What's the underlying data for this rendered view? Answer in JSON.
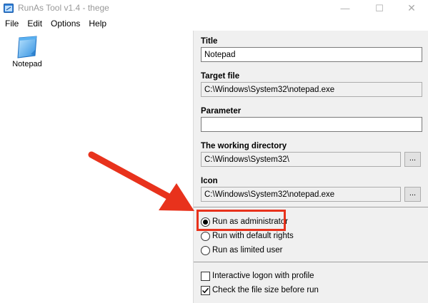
{
  "window": {
    "title": "RunAs Tool v1.4 - thege",
    "minimize_glyph": "—",
    "maximize_glyph": "☐",
    "close_glyph": "✕"
  },
  "menu": [
    "File",
    "Edit",
    "Options",
    "Help"
  ],
  "shortcuts": [
    {
      "label": "Notepad",
      "icon": "notepad-icon"
    }
  ],
  "form": {
    "title_label": "Title",
    "title_value": "Notepad",
    "target_label": "Target file",
    "target_value": "C:\\Windows\\System32\\notepad.exe",
    "parameter_label": "Parameter",
    "parameter_value": "",
    "workdir_label": "The working directory",
    "workdir_value": "C:\\Windows\\System32\\",
    "icon_label": "Icon",
    "icon_value": "C:\\Windows\\System32\\notepad.exe",
    "browse_label": "..."
  },
  "run_options": {
    "selected": "admin",
    "admin_label": "Run as administrator",
    "default_label": "Run with default rights",
    "limited_label": "Run as limited user"
  },
  "checks": {
    "interactive_label": "Interactive logon with profile",
    "interactive_checked": false,
    "filesize_label": "Check the file size before run",
    "filesize_checked": true
  },
  "colors": {
    "annotation": "#e8321c",
    "pane_bg": "#f0f0f0"
  }
}
